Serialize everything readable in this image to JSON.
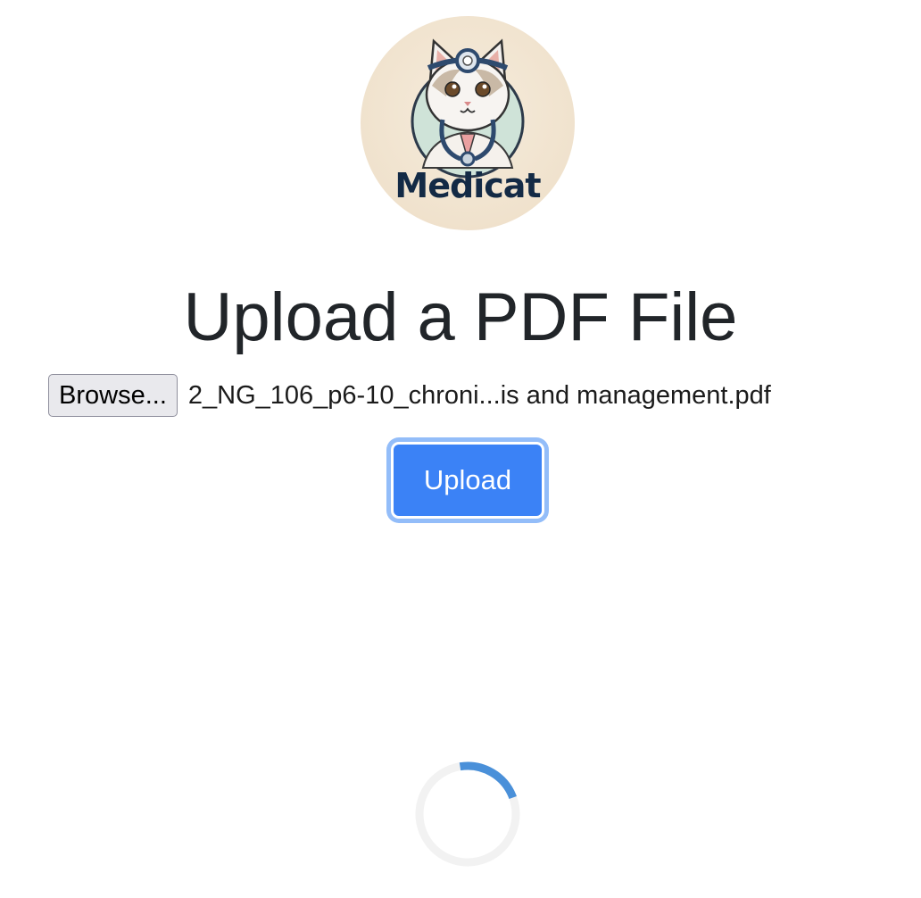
{
  "logo": {
    "text": "Medicat",
    "icon": "cat-doctor-logo",
    "background": "#f0e2cd",
    "text_color": "#132a45"
  },
  "page": {
    "title": "Upload a PDF File"
  },
  "file_input": {
    "browse_label": "Browse...",
    "selected_file": "2_NG_106_p6-10_chroni...is and management.pdf"
  },
  "upload_button": {
    "label": "Upload",
    "color": "#3b82f6"
  },
  "spinner": {
    "icon": "loading-spinner-icon",
    "track_color": "#f2f2f2",
    "arc_color": "#4a90d9"
  }
}
